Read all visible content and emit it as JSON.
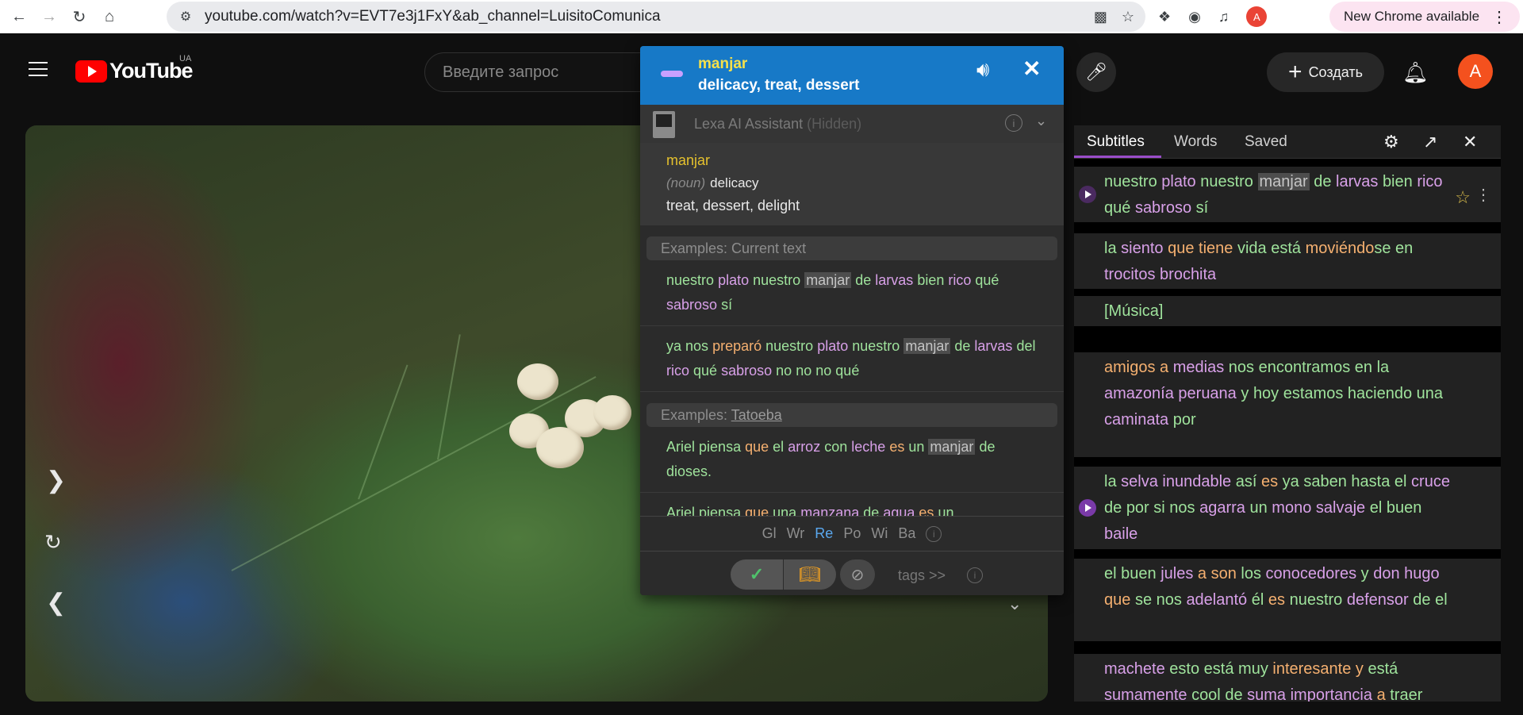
{
  "browser": {
    "url": "youtube.com/watch?v=EVT7e3j1FxY&ab_channel=LuisitoComunica",
    "update_label": "New Chrome available",
    "profile_initial": "A"
  },
  "youtube": {
    "logo_text": "YouTube",
    "country_code": "UA",
    "search_placeholder": "Введите запрос",
    "create_label": "Создать",
    "avatar_initial": "A"
  },
  "lexa": {
    "word": "manjar",
    "translation": "delicacy, treat, dessert",
    "ai_label": "Lexa AI Assistant",
    "ai_hidden": "(Hidden)",
    "definition": {
      "word": "manjar",
      "pos": "(noun)",
      "main": "delicacy",
      "synonyms": "treat, dessert, delight"
    },
    "examples_current_title": "Examples: Current text",
    "examples_tatoeba_prefix": "Examples: ",
    "examples_tatoeba_link": "Tatoeba",
    "examples_current": [
      [
        [
          "nuestro",
          "g"
        ],
        [
          "plato",
          "p"
        ],
        [
          "nuestro",
          "g"
        ],
        [
          "manjar",
          "hl"
        ],
        [
          "de",
          "g"
        ],
        [
          "larvas",
          "p"
        ],
        [
          "bien",
          "g"
        ],
        [
          "rico",
          "p"
        ],
        [
          "qué",
          "g"
        ],
        [
          "sabroso",
          "p"
        ],
        [
          "sí",
          "g"
        ]
      ],
      [
        [
          "ya",
          "g"
        ],
        [
          "nos",
          "g"
        ],
        [
          "preparó",
          "o"
        ],
        [
          "nuestro",
          "g"
        ],
        [
          "plato",
          "p"
        ],
        [
          "nuestro",
          "g"
        ],
        [
          "manjar",
          "hl"
        ],
        [
          "de",
          "g"
        ],
        [
          "larvas",
          "p"
        ],
        [
          "del",
          "g"
        ],
        [
          "rico",
          "p"
        ],
        [
          "qué",
          "g"
        ],
        [
          "sabroso",
          "p"
        ],
        [
          "no",
          "g"
        ],
        [
          "no",
          "g"
        ],
        [
          "no",
          "g"
        ],
        [
          "qué",
          "g"
        ]
      ]
    ],
    "examples_tatoeba": [
      [
        [
          "Ariel",
          "g"
        ],
        [
          "piensa",
          "g"
        ],
        [
          "que",
          "o"
        ],
        [
          "el",
          "g"
        ],
        [
          "arroz",
          "p"
        ],
        [
          "con",
          "g"
        ],
        [
          "leche",
          "p"
        ],
        [
          "es",
          "o"
        ],
        [
          "un",
          "g"
        ],
        [
          "manjar",
          "hl"
        ],
        [
          "de",
          "g"
        ],
        [
          "dioses.",
          "g"
        ]
      ],
      [
        [
          "Ariel",
          "g"
        ],
        [
          "piensa",
          "g"
        ],
        [
          "que",
          "o"
        ],
        [
          "una",
          "g"
        ],
        [
          "manzana",
          "p"
        ],
        [
          "de",
          "g"
        ],
        [
          "agua",
          "p"
        ],
        [
          "es",
          "o"
        ],
        [
          "un",
          "g"
        ]
      ]
    ],
    "dictionaries": [
      "Gl",
      "Wr",
      "Re",
      "Po",
      "Wi",
      "Ba"
    ],
    "active_dictionary": "Re",
    "tags_label": "tags >>",
    "info_glyph": "i"
  },
  "subtitles": {
    "tabs": [
      "Subtitles",
      "Words",
      "Saved"
    ],
    "active_tab": "Subtitles",
    "lines": [
      {
        "words": [
          [
            "nuestro",
            "g"
          ],
          [
            "plato",
            "p"
          ],
          [
            "nuestro",
            "g"
          ],
          [
            "manjar",
            "hl"
          ],
          [
            "de",
            "g"
          ],
          [
            "larvas",
            "p"
          ],
          [
            "bien",
            "g"
          ],
          [
            "rico",
            "p"
          ],
          [
            "qué",
            "g"
          ],
          [
            "sabroso",
            "p"
          ],
          [
            "sí",
            "g"
          ]
        ],
        "playing": true,
        "dim": true
      },
      {
        "words": [
          [
            "la",
            "g"
          ],
          [
            "siento",
            "p"
          ],
          [
            "que",
            "o"
          ],
          [
            "tiene",
            "o"
          ],
          [
            "vida",
            "g"
          ],
          [
            "está",
            "g"
          ],
          [
            "moviéndo",
            "o"
          ],
          [
            "se",
            "g"
          ],
          [
            "en",
            "g"
          ],
          [
            "trocitos",
            "p"
          ],
          [
            "brochita",
            "p"
          ]
        ],
        "playing": false
      },
      {
        "words": [
          [
            "[Música]",
            "g"
          ]
        ],
        "playing": false
      },
      {
        "words": [
          [
            "amigos",
            "o"
          ],
          [
            "a",
            "o"
          ],
          [
            "medias",
            "p"
          ],
          [
            "nos",
            "g"
          ],
          [
            "encontramos",
            "g"
          ],
          [
            "en",
            "g"
          ],
          [
            "la",
            "g"
          ],
          [
            "amazonía",
            "p"
          ],
          [
            "peruana",
            "p"
          ],
          [
            "y",
            "g"
          ],
          [
            "hoy",
            "g"
          ],
          [
            "estamos",
            "g"
          ],
          [
            "haciendo",
            "g"
          ],
          [
            "una",
            "g"
          ],
          [
            "caminata",
            "p"
          ],
          [
            "por",
            "g"
          ]
        ],
        "playing": false
      },
      {
        "words": [
          [
            "la",
            "g"
          ],
          [
            "selva",
            "p"
          ],
          [
            "inundable",
            "p"
          ],
          [
            "así",
            "g"
          ],
          [
            "es",
            "o"
          ],
          [
            "ya",
            "g"
          ],
          [
            "saben",
            "g"
          ],
          [
            "hasta",
            "g"
          ],
          [
            "el",
            "g"
          ],
          [
            "cruce",
            "p"
          ],
          [
            "de",
            "g"
          ],
          [
            "por",
            "g"
          ],
          [
            "si",
            "g"
          ],
          [
            "nos",
            "g"
          ],
          [
            "agarra",
            "p"
          ],
          [
            "un",
            "g"
          ],
          [
            "mono",
            "p"
          ],
          [
            "salvaje",
            "p"
          ],
          [
            "el",
            "g"
          ],
          [
            "buen",
            "g"
          ],
          [
            "baile",
            "p"
          ]
        ],
        "playing": true
      },
      {
        "words": [
          [
            "el",
            "g"
          ],
          [
            "buen",
            "g"
          ],
          [
            "jules",
            "p"
          ],
          [
            "a",
            "o"
          ],
          [
            "son",
            "o"
          ],
          [
            "los",
            "g"
          ],
          [
            "conocedores",
            "p"
          ],
          [
            "y",
            "g"
          ],
          [
            "don",
            "p"
          ],
          [
            "hugo",
            "p"
          ],
          [
            "que",
            "o"
          ],
          [
            "se",
            "g"
          ],
          [
            "nos",
            "g"
          ],
          [
            "adelantó",
            "p"
          ],
          [
            "él",
            "g"
          ],
          [
            "es",
            "o"
          ],
          [
            "nuestro",
            "g"
          ],
          [
            "defensor",
            "p"
          ],
          [
            "de",
            "g"
          ],
          [
            "el",
            "g"
          ]
        ],
        "playing": false
      },
      {
        "words": [
          [
            "machete",
            "p"
          ],
          [
            "esto",
            "g"
          ],
          [
            "está",
            "g"
          ],
          [
            "muy",
            "g"
          ],
          [
            "interesante",
            "o"
          ],
          [
            "y",
            "o"
          ],
          [
            "está",
            "g"
          ],
          [
            "sumamente",
            "p"
          ],
          [
            "cool",
            "g"
          ],
          [
            "de",
            "g"
          ],
          [
            "suma",
            "p"
          ],
          [
            "importancia",
            "p"
          ],
          [
            "a",
            "o"
          ],
          [
            "traer",
            "g"
          ]
        ],
        "playing": false
      }
    ]
  },
  "colors": {
    "lexa_header": "#1779c7",
    "word_yellow": "#f5e04a",
    "known_green": "#9fe39c",
    "learning_purple": "#d8a0e8",
    "new_orange": "#f5b070",
    "tab_underline": "#9a4dc9"
  },
  "icons": {
    "back": "arrow-left-icon",
    "forward": "arrow-right-icon",
    "reload": "reload-icon",
    "home": "home-icon",
    "site_info": "tune-icon",
    "install": "install-icon",
    "bookmark": "star-icon",
    "extensions": "puzzle-icon",
    "mic": "mic-icon",
    "bell": "bell-icon",
    "speaker": "speaker-icon",
    "settings": "gear-icon",
    "export": "export-icon",
    "close": "close-icon"
  }
}
